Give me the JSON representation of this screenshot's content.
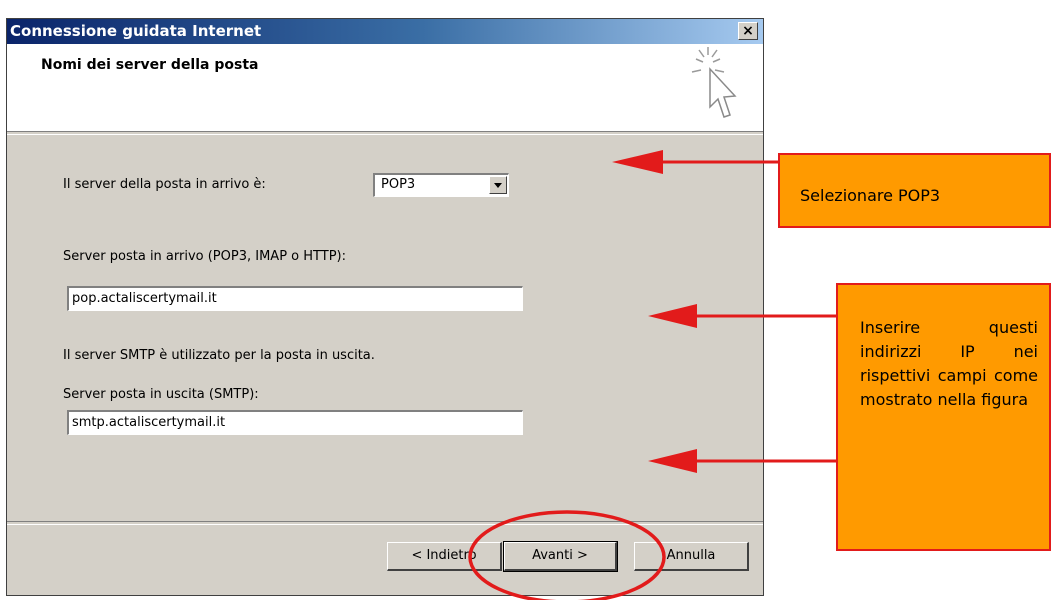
{
  "window": {
    "title": "Connessione guidata Internet",
    "close_glyph": "×"
  },
  "header": {
    "title": "Nomi dei server della posta",
    "icon": "wizard-cursor-sparkle-icon"
  },
  "form": {
    "incoming_type_label": "Il server della posta in arrivo è:",
    "incoming_type_value": "POP3",
    "incoming_server_label": "Server posta in arrivo (POP3, IMAP o HTTP):",
    "incoming_server_value": "pop.actaliscertymail.it",
    "smtp_info": "Il server SMTP è utilizzato per la posta in uscita.",
    "outgoing_server_label": "Server posta in uscita (SMTP):",
    "outgoing_server_value": "smtp.actaliscertymail.it"
  },
  "buttons": {
    "back": "< Indietro",
    "next": "Avanti >",
    "cancel": "Annulla"
  },
  "annotations": {
    "callout_select": "Selezionare  POP3",
    "callout_fields": "Inserire questi indirizzi IP nei rispettivi campi come mostrato nella figura",
    "arrow_color": "#e21b1b",
    "callout_color": "#ff9a00"
  }
}
